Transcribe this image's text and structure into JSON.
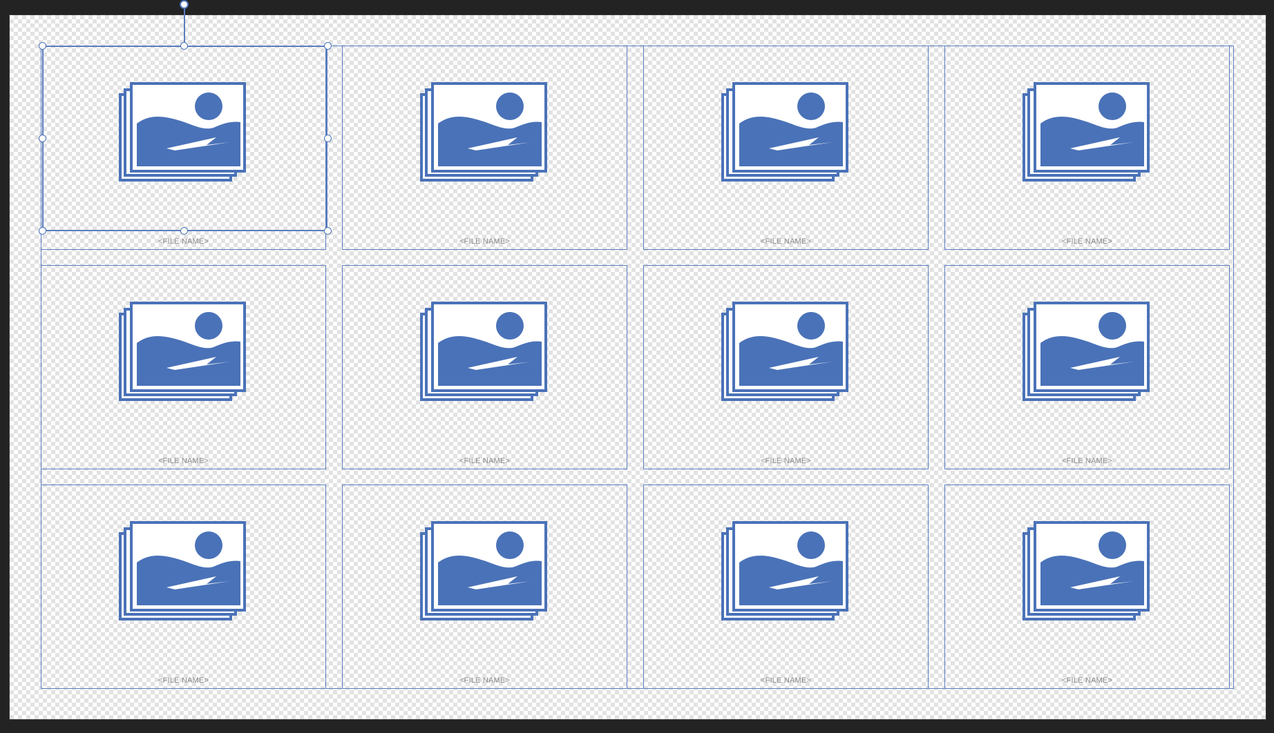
{
  "canvas": {
    "colors": {
      "workspace": "#232323",
      "artboard": "#ffffff",
      "transparency_check": "#e2e2e2",
      "frame_border": "#5a7dc0",
      "placeholder_fill": "#4a72b8",
      "caption": "#8a8a8a"
    },
    "grid": {
      "rows": 3,
      "columns": 4
    },
    "placeholder_icon": "image-stack-icon",
    "selected_cell": 0
  },
  "cells": [
    {
      "caption": "<FILE NAME>"
    },
    {
      "caption": "<FILE NAME>"
    },
    {
      "caption": "<FILE NAME>"
    },
    {
      "caption": "<FILE NAME>"
    },
    {
      "caption": "<FILE NAME>"
    },
    {
      "caption": "<FILE NAME>"
    },
    {
      "caption": "<FILE NAME>"
    },
    {
      "caption": "<FILE NAME>"
    },
    {
      "caption": "<FILE NAME>"
    },
    {
      "caption": "<FILE NAME>"
    },
    {
      "caption": "<FILE NAME>"
    },
    {
      "caption": "<FILE NAME>"
    }
  ]
}
